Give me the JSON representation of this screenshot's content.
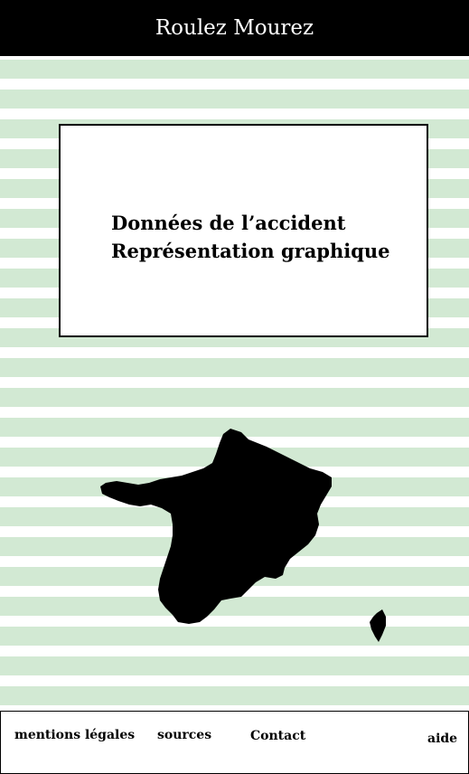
{
  "header": {
    "title": "Roulez Mourez"
  },
  "content": {
    "line1": "Données de l’accident",
    "line2": "Représentation graphique"
  },
  "map": {
    "icon": "france-map-icon"
  },
  "footer": {
    "legal": "mentions légales",
    "sources": "sources",
    "contact": "Contact",
    "help": "aide"
  },
  "colors": {
    "stripe": "#d2e9d3",
    "header_bg": "#000000",
    "text": "#000000"
  }
}
